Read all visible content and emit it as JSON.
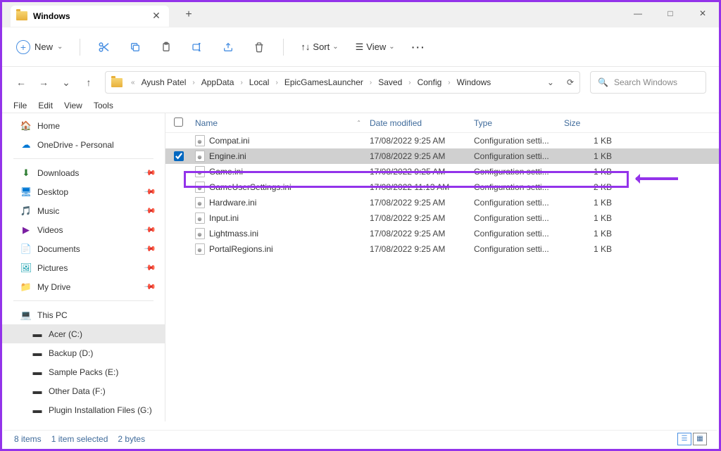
{
  "tab": {
    "title": "Windows"
  },
  "toolbar": {
    "new_label": "New",
    "sort_label": "Sort",
    "view_label": "View"
  },
  "breadcrumbs": [
    "Ayush Patel",
    "AppData",
    "Local",
    "EpicGamesLauncher",
    "Saved",
    "Config",
    "Windows"
  ],
  "search": {
    "placeholder": "Search Windows"
  },
  "menubar": [
    "File",
    "Edit",
    "View",
    "Tools"
  ],
  "sidebar": {
    "home": "Home",
    "onedrive": "OneDrive - Personal",
    "quick": [
      "Downloads",
      "Desktop",
      "Music",
      "Videos",
      "Documents",
      "Pictures",
      "My Drive"
    ],
    "thispc": "This PC",
    "drives": [
      "Acer (C:)",
      "Backup (D:)",
      "Sample Packs (E:)",
      "Other Data (F:)",
      "Plugin Installation Files (G:)"
    ]
  },
  "columns": {
    "name": "Name",
    "date": "Date modified",
    "type": "Type",
    "size": "Size"
  },
  "files": [
    {
      "name": "Compat.ini",
      "date": "17/08/2022 9:25 AM",
      "type": "Configuration setti...",
      "size": "1 KB",
      "selected": false
    },
    {
      "name": "Engine.ini",
      "date": "17/08/2022 9:25 AM",
      "type": "Configuration setti...",
      "size": "1 KB",
      "selected": true
    },
    {
      "name": "Game.ini",
      "date": "17/08/2022 9:25 AM",
      "type": "Configuration setti...",
      "size": "1 KB",
      "selected": false
    },
    {
      "name": "GameUserSettings.ini",
      "date": "17/08/2022 11:13 AM",
      "type": "Configuration setti...",
      "size": "2 KB",
      "selected": false
    },
    {
      "name": "Hardware.ini",
      "date": "17/08/2022 9:25 AM",
      "type": "Configuration setti...",
      "size": "1 KB",
      "selected": false
    },
    {
      "name": "Input.ini",
      "date": "17/08/2022 9:25 AM",
      "type": "Configuration setti...",
      "size": "1 KB",
      "selected": false
    },
    {
      "name": "Lightmass.ini",
      "date": "17/08/2022 9:25 AM",
      "type": "Configuration setti...",
      "size": "1 KB",
      "selected": false
    },
    {
      "name": "PortalRegions.ini",
      "date": "17/08/2022 9:25 AM",
      "type": "Configuration setti...",
      "size": "1 KB",
      "selected": false
    }
  ],
  "status": {
    "count": "8 items",
    "selected": "1 item selected",
    "bytes": "2 bytes"
  }
}
